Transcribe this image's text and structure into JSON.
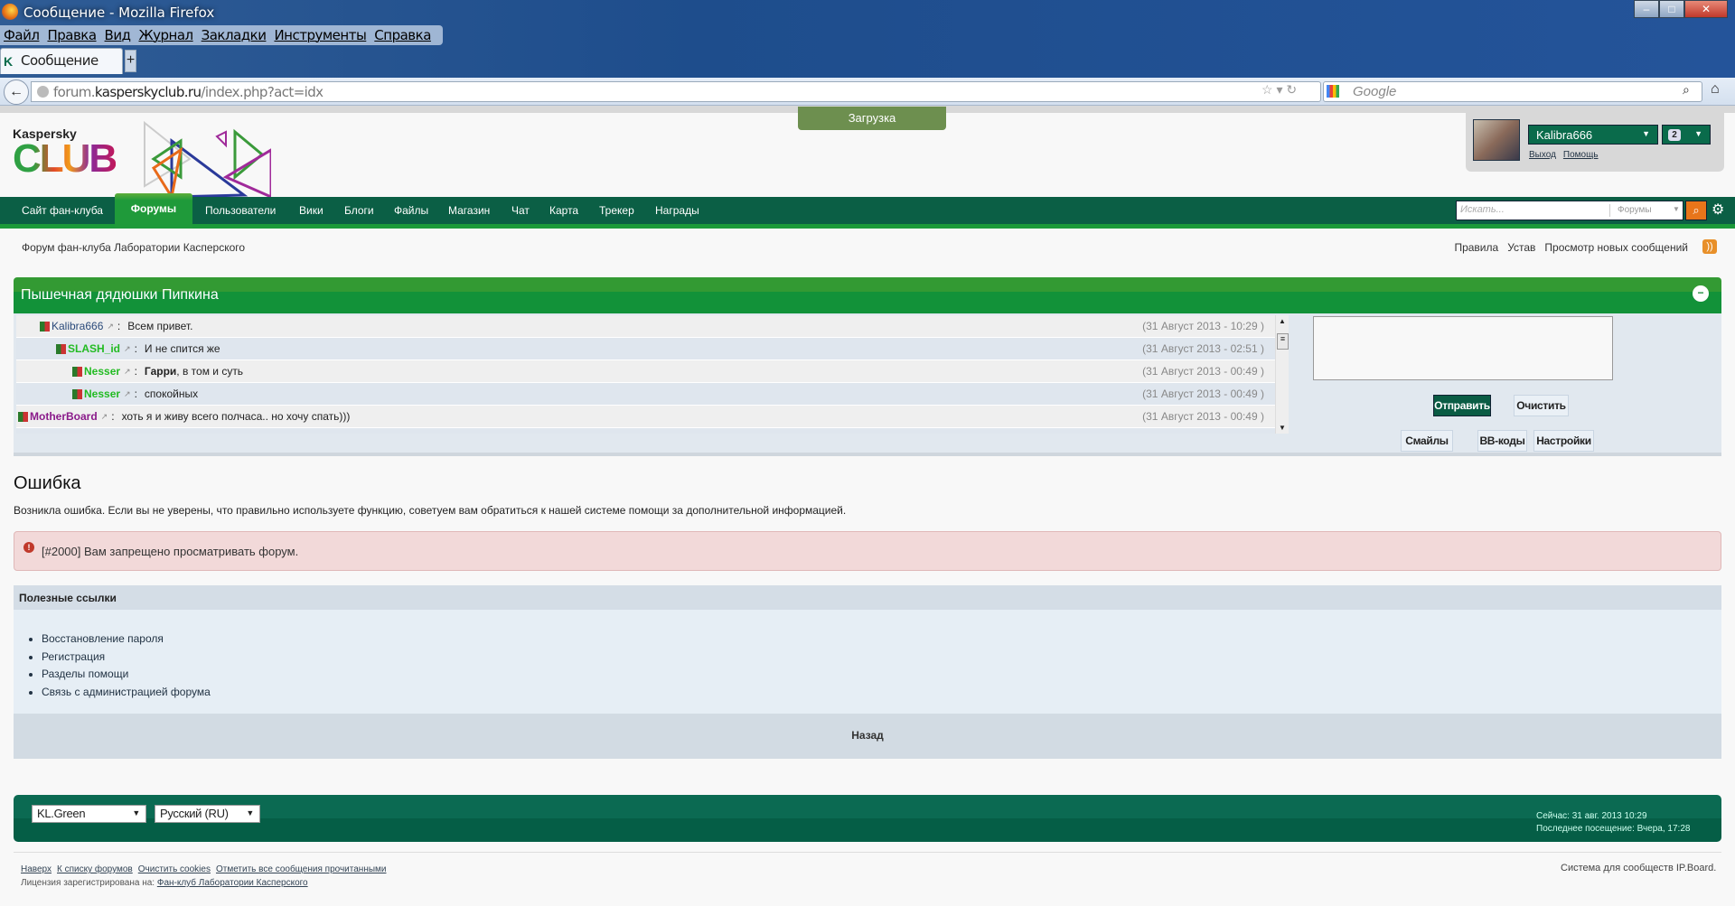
{
  "browser": {
    "title": "Сообщение - Mozilla Firefox",
    "menu": [
      "Файл",
      "Правка",
      "Вид",
      "Журнал",
      "Закладки",
      "Инструменты",
      "Справка"
    ],
    "tab": "Сообщение",
    "new_tab": "+",
    "url_prefix": "forum.",
    "url_domain": "kasperskyclub.ru",
    "url_path": "/index.php?act=idx",
    "search_placeholder": "Google"
  },
  "loading": "Загрузка",
  "logo": {
    "brand": "Kaspersky",
    "club": "CLUB"
  },
  "user": {
    "name": "Kalibra666",
    "messages": "2",
    "logout": "Выход",
    "help": "Помощь"
  },
  "nav": {
    "items": [
      "Сайт фан-клуба",
      "Форумы",
      "Пользователи",
      "Вики",
      "Блоги",
      "Файлы",
      "Магазин",
      "Чат",
      "Карта",
      "Трекер",
      "Награды"
    ],
    "search_placeholder": "Искать...",
    "search_scope": "Форумы"
  },
  "breadcrumb": "Форум фан-клуба Лаборатории Касперского",
  "toplinks": [
    "Правила",
    "Устав",
    "Просмотр новых сообщений"
  ],
  "shoutbox": {
    "title": "Пышечная дядюшки Пипкина",
    "shouts": [
      {
        "user": "Kalibra666",
        "color": "#2a4a7a",
        "indent": 0,
        "bold": "",
        "text": "Всем привет.",
        "time": "(31 Август 2013 - 10:29 )"
      },
      {
        "user": "SLASH_id",
        "color": "#22bb22",
        "indent": 1,
        "bold": "",
        "text": "И не спится же",
        "time": "(31 Август 2013 - 02:51 )"
      },
      {
        "user": "Nesser",
        "color": "#22bb22",
        "indent": 2,
        "bold": "Гарри",
        "text": ", в том и суть",
        "time": "(31 Август 2013 - 00:49 )"
      },
      {
        "user": "Nesser",
        "color": "#22bb22",
        "indent": 2,
        "bold": "",
        "text": "спокойных",
        "time": "(31 Август 2013 - 00:49 )"
      },
      {
        "user": "MotherBoard",
        "color": "#8a1a8a",
        "indent": -1,
        "bold": "",
        "text": "хоть я и живу всего полчаса.. но хочу спать)))",
        "time": "(31 Август 2013 - 00:49 )"
      }
    ],
    "send": "Отправить",
    "clear": "Очистить",
    "smiles": "Смайлы",
    "bbcodes": "BB-коды",
    "settings": "Настройки"
  },
  "error": {
    "heading": "Ошибка",
    "text": "Возникла ошибка. Если вы не уверены, что правильно используете функцию, советуем вам обратиться к нашей системе помощи за дополнительной информацией.",
    "message": "[#2000] Вам запрещено просматривать форум."
  },
  "useful": {
    "title": "Полезные ссылки",
    "links": [
      "Восстановление пароля",
      "Регистрация",
      "Разделы помощи",
      "Связь с администрацией форума"
    ],
    "back": "Назад"
  },
  "footer": {
    "skin": "KL.Green",
    "lang": "Русский (RU)",
    "now": "Сейчас: 31 авг. 2013 10:29",
    "last_visit": "Последнее посещение: Вчера, 17:28",
    "links": [
      "Наверх",
      "К списку форумов",
      "Очистить cookies",
      "Отметить все сообщения прочитанными"
    ],
    "license_label": "Лицензия зарегистрирована на:",
    "license_link": "Фан-клуб Лаборатории Касперского",
    "powered": "Система для сообществ IP.Board."
  }
}
